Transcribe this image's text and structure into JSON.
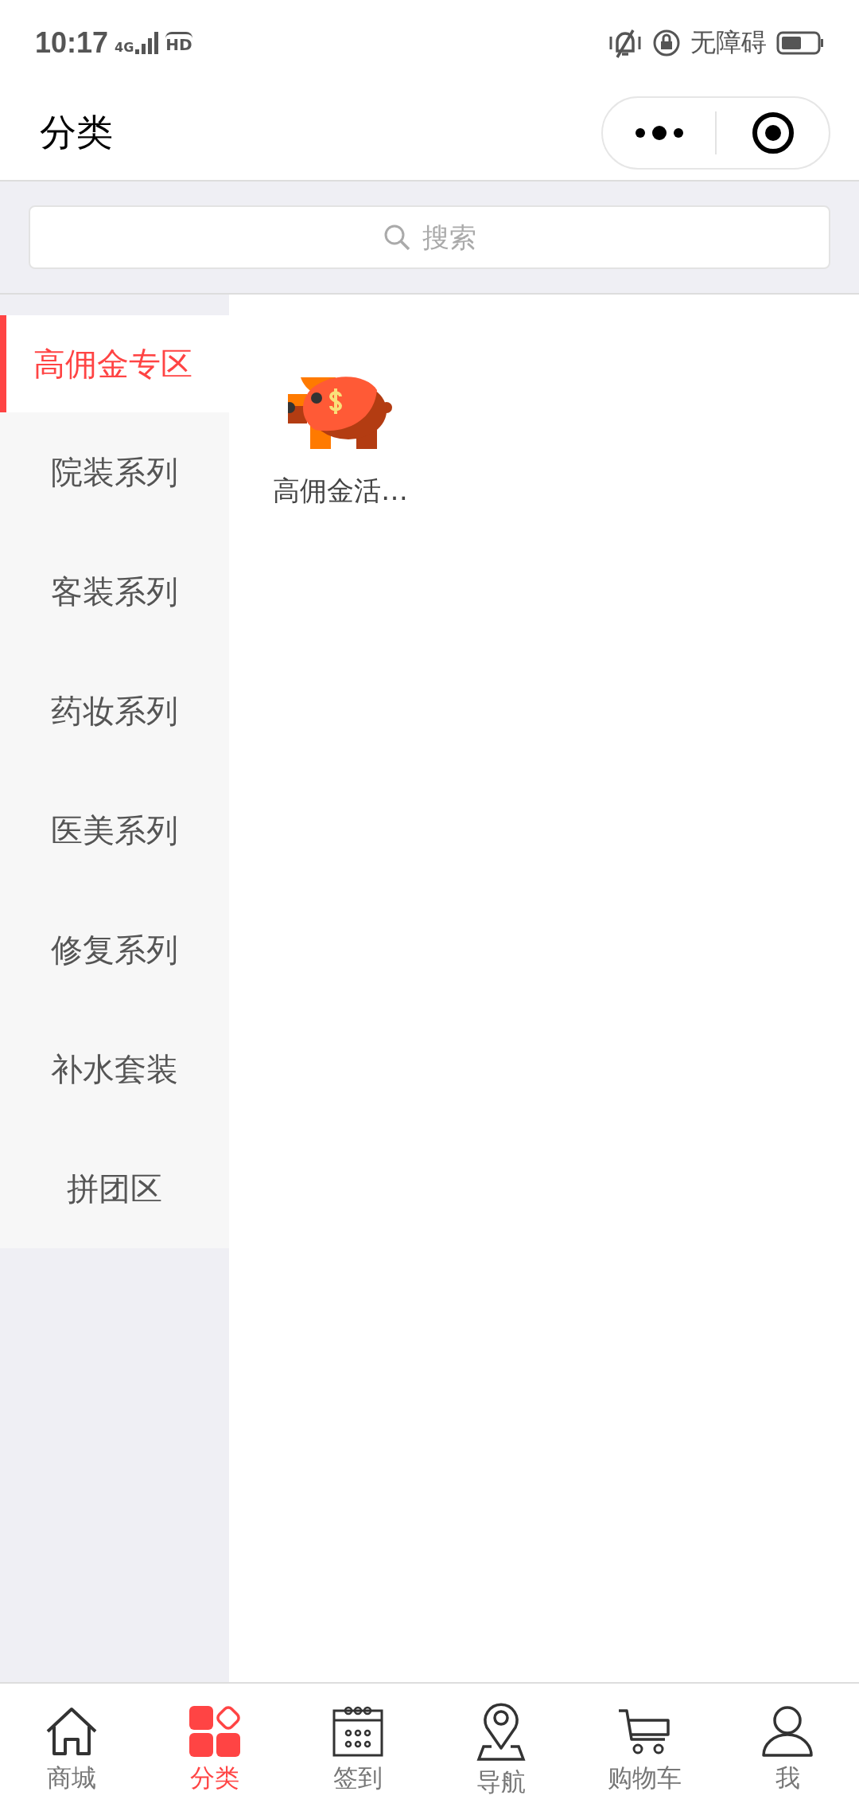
{
  "status_bar": {
    "time": "10:17",
    "network": "4G",
    "hd": "HD",
    "accessibility": "无障碍"
  },
  "header": {
    "title": "分类"
  },
  "search": {
    "placeholder": "搜索"
  },
  "sidebar": {
    "items": [
      {
        "label": "高佣金专区",
        "selected": true
      },
      {
        "label": "院装系列",
        "selected": false
      },
      {
        "label": "客装系列",
        "selected": false
      },
      {
        "label": "药妆系列",
        "selected": false
      },
      {
        "label": "医美系列",
        "selected": false
      },
      {
        "label": "修复系列",
        "selected": false
      },
      {
        "label": "补水套装",
        "selected": false
      },
      {
        "label": "拼团区",
        "selected": false
      }
    ]
  },
  "content": {
    "items": [
      {
        "label": "高佣金活…",
        "kind": "piggy"
      }
    ]
  },
  "tab_bar": {
    "items": [
      {
        "label": "商城",
        "kind": "home",
        "selected": false
      },
      {
        "label": "分类",
        "kind": "grid",
        "selected": true
      },
      {
        "label": "签到",
        "kind": "calendar",
        "selected": false
      },
      {
        "label": "导航",
        "kind": "pin",
        "selected": false
      },
      {
        "label": "购物车",
        "kind": "cart",
        "selected": false
      },
      {
        "label": "我",
        "kind": "person",
        "selected": false
      }
    ]
  }
}
